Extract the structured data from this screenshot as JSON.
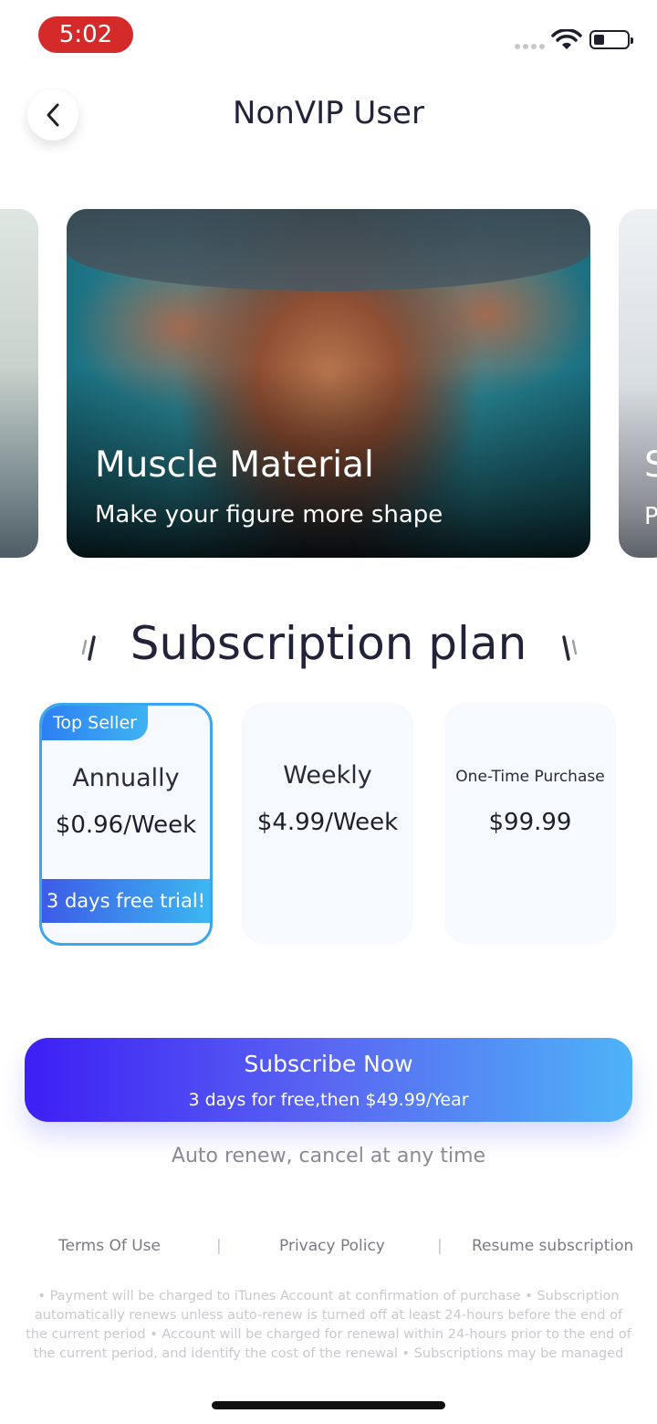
{
  "status_bar": {
    "time": "5:02"
  },
  "header": {
    "title": "NonVIP User"
  },
  "carousel": {
    "main": {
      "title": "Muscle Material",
      "subtitle": "Make your figure more shape"
    },
    "right_peek": {
      "title_initial": "S",
      "subtitle_initial": "P"
    }
  },
  "section": {
    "heading": "Subscription plan"
  },
  "plans": [
    {
      "badge": "Top Seller",
      "name": "Annually",
      "price": "$0.96/Week",
      "trial": "3 days free trial!",
      "selected": true
    },
    {
      "name": "Weekly",
      "price": "$4.99/Week",
      "selected": false
    },
    {
      "name": "One-Time Purchase",
      "price": "$99.99",
      "selected": false
    }
  ],
  "cta": {
    "label": "Subscribe Now",
    "sub_label": "3 days for free,then $49.99/Year"
  },
  "auto_renew": "Auto renew, cancel at any time",
  "links": {
    "terms": "Terms Of Use",
    "privacy": "Privacy Policy",
    "resume": "Resume subscription",
    "separator": "|"
  },
  "legal": "• Payment will be charged to iTunes Account at confirmation of purchase • Subscription automatically renews unless auto-renew is turned off at least 24-hours before the end of the current period • Account will be charged for renewal within 24-hours prior to the end of the current period, and identify the cost of the renewal • Subscriptions may be managed by the",
  "colors": {
    "accent_blue": "#3aa6ee",
    "status_pill": "#d42a2a",
    "cta_start": "#3d1ff5",
    "cta_end": "#4db3f7"
  },
  "icons": {
    "back": "chevron-left-icon",
    "wifi": "wifi-icon",
    "battery": "battery-icon",
    "signal": "signal-dots-icon"
  }
}
